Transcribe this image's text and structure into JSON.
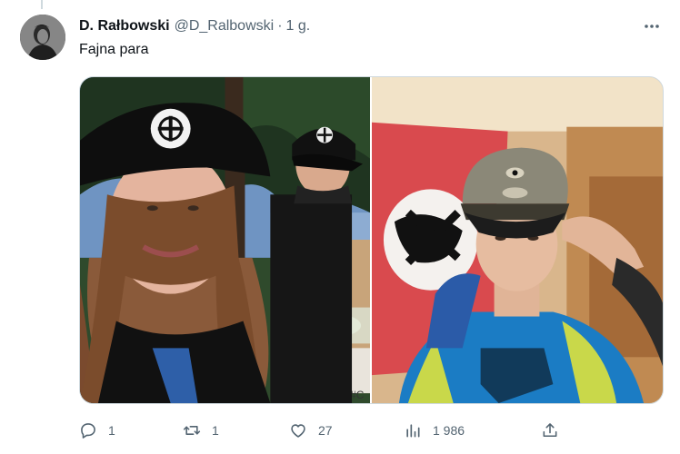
{
  "tweet": {
    "display_name": "D. Rałbowski",
    "handle": "@D_Ralbowski",
    "separator": "·",
    "time": "1 g.",
    "text": "Fajna para",
    "more_icon": "more-horizontal-icon",
    "photos": [
      {
        "description_icon": "photo-left",
        "watermark": "#C"
      },
      {
        "description_icon": "photo-right"
      }
    ]
  },
  "actions": {
    "reply_count": "1",
    "retweet_count": "1",
    "like_count": "27",
    "views_count": "1 986"
  },
  "colors": {
    "secondary_text": "#536471",
    "border": "#cfd9de"
  }
}
